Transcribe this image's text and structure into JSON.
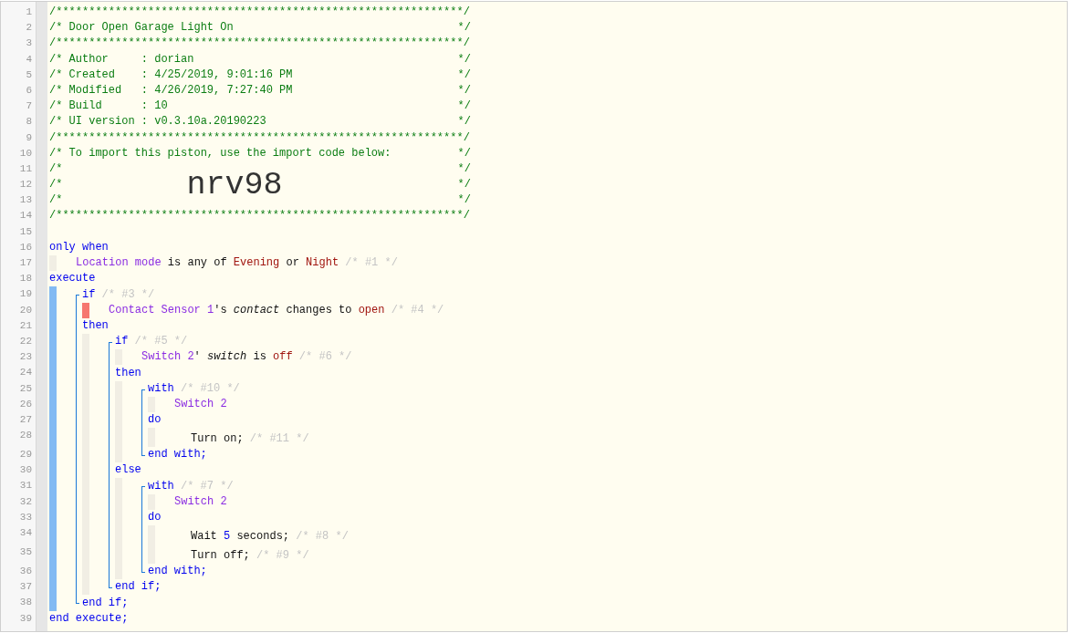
{
  "header": [
    {
      "number": "1",
      "text": "/**************************************************************/"
    },
    {
      "number": "2",
      "text": "/* Door Open Garage Light On",
      "end": "*/"
    },
    {
      "number": "3",
      "text": "/**************************************************************/"
    },
    {
      "number": "4",
      "text": "/* Author     : dorian",
      "end": "*/"
    },
    {
      "number": "5",
      "text": "/* Created    : 4/25/2019, 9:01:16 PM",
      "end": "*/"
    },
    {
      "number": "6",
      "text": "/* Modified   : 4/26/2019, 7:27:40 PM",
      "end": "*/"
    },
    {
      "number": "7",
      "text": "/* Build      : 10",
      "end": "*/"
    },
    {
      "number": "8",
      "text": "/* UI version : v0.3.10a.20190223",
      "end": "*/"
    },
    {
      "number": "9",
      "text": "/**************************************************************/"
    },
    {
      "number": "10",
      "text": "/* To import this piston, use the import code below:",
      "end": "*/"
    },
    {
      "number": "11",
      "text": "/*",
      "end": "*/"
    },
    {
      "number": "12",
      "text": "/*",
      "import_code": "nrv98",
      "end": "*/"
    },
    {
      "number": "13",
      "text": "/*",
      "end": "*/"
    },
    {
      "number": "14",
      "text": "/**************************************************************/"
    }
  ],
  "program": [
    {
      "kind": "line",
      "number": "15"
    },
    {
      "kind": "line",
      "number": "16",
      "tokens": [
        {
          "kind": "keyword",
          "text": "only when"
        }
      ]
    },
    {
      "kind": "body",
      "selected": false,
      "flagged": false,
      "children": [
        {
          "kind": "line",
          "number": "17",
          "tokens": [
            {
              "kind": "device",
              "text": "Location mode"
            },
            {
              "kind": "plain",
              "text": " is any of "
            },
            {
              "kind": "value",
              "text": "Evening"
            },
            {
              "kind": "plain",
              "text": " or "
            },
            {
              "kind": "value",
              "text": "Night"
            },
            {
              "kind": "hint",
              "text": " /* #1 */"
            }
          ]
        }
      ]
    },
    {
      "kind": "line",
      "number": "18",
      "tokens": [
        {
          "kind": "keyword",
          "text": "execute"
        }
      ]
    },
    {
      "kind": "body",
      "selected": true,
      "flagged": false,
      "children": [
        {
          "kind": "bracket",
          "children": [
            {
              "kind": "line",
              "number": "19",
              "tokens": [
                {
                  "kind": "keyword",
                  "text": "if"
                },
                {
                  "kind": "hint",
                  "text": " /* #3 */"
                }
              ]
            },
            {
              "kind": "body",
              "selected": false,
              "flagged": true,
              "children": [
                {
                  "kind": "line",
                  "number": "20",
                  "tokens": [
                    {
                      "kind": "device",
                      "text": "Contact Sensor 1"
                    },
                    {
                      "kind": "plain",
                      "text": "'s "
                    },
                    {
                      "kind": "attribute",
                      "text": "contact"
                    },
                    {
                      "kind": "plain",
                      "text": " changes to "
                    },
                    {
                      "kind": "value",
                      "text": "open"
                    },
                    {
                      "kind": "hint",
                      "text": " /* #4 */"
                    }
                  ]
                }
              ]
            },
            {
              "kind": "line",
              "number": "21",
              "tokens": [
                {
                  "kind": "keyword",
                  "text": "then"
                }
              ]
            },
            {
              "kind": "body",
              "selected": false,
              "flagged": false,
              "children": [
                {
                  "kind": "bracket",
                  "children": [
                    {
                      "kind": "line",
                      "number": "22",
                      "tokens": [
                        {
                          "kind": "keyword",
                          "text": "if"
                        },
                        {
                          "kind": "hint",
                          "text": " /* #5 */"
                        }
                      ]
                    },
                    {
                      "kind": "body",
                      "selected": false,
                      "flagged": false,
                      "children": [
                        {
                          "kind": "line",
                          "number": "23",
                          "tokens": [
                            {
                              "kind": "device",
                              "text": "Switch 2"
                            },
                            {
                              "kind": "plain",
                              "text": "' "
                            },
                            {
                              "kind": "attribute",
                              "text": "switch"
                            },
                            {
                              "kind": "plain",
                              "text": " is "
                            },
                            {
                              "kind": "value",
                              "text": "off"
                            },
                            {
                              "kind": "hint",
                              "text": " /* #6 */"
                            }
                          ]
                        }
                      ]
                    },
                    {
                      "kind": "line",
                      "number": "24",
                      "tokens": [
                        {
                          "kind": "keyword",
                          "text": "then"
                        }
                      ]
                    },
                    {
                      "kind": "body",
                      "selected": false,
                      "flagged": false,
                      "children": [
                        {
                          "kind": "bracket",
                          "children": [
                            {
                              "kind": "line",
                              "number": "25",
                              "tokens": [
                                {
                                  "kind": "keyword",
                                  "text": "with"
                                },
                                {
                                  "kind": "hint",
                                  "text": " /* #10 */"
                                }
                              ]
                            },
                            {
                              "kind": "body",
                              "selected": false,
                              "flagged": false,
                              "children": [
                                {
                                  "kind": "line",
                                  "number": "26",
                                  "tokens": [
                                    {
                                      "kind": "device",
                                      "text": "Switch 2"
                                    }
                                  ]
                                }
                              ]
                            },
                            {
                              "kind": "line",
                              "number": "27",
                              "tokens": [
                                {
                                  "kind": "keyword",
                                  "text": "do"
                                }
                              ]
                            },
                            {
                              "kind": "body",
                              "selected": false,
                              "flagged": false,
                              "children": [
                                {
                                  "kind": "action",
                                  "number": "28",
                                  "tokens": [
                                    {
                                      "kind": "plain",
                                      "text": "Turn on;"
                                    },
                                    {
                                      "kind": "hint",
                                      "text": " /* #11 */"
                                    }
                                  ]
                                }
                              ]
                            },
                            {
                              "kind": "line",
                              "number": "29",
                              "tokens": [
                                {
                                  "kind": "keyword",
                                  "text": "end with;"
                                }
                              ]
                            }
                          ]
                        }
                      ]
                    },
                    {
                      "kind": "line",
                      "number": "30",
                      "tokens": [
                        {
                          "kind": "keyword",
                          "text": "else"
                        }
                      ]
                    },
                    {
                      "kind": "body",
                      "selected": false,
                      "flagged": false,
                      "children": [
                        {
                          "kind": "bracket",
                          "children": [
                            {
                              "kind": "line",
                              "number": "31",
                              "tokens": [
                                {
                                  "kind": "keyword",
                                  "text": "with"
                                },
                                {
                                  "kind": "hint",
                                  "text": " /* #7 */"
                                }
                              ]
                            },
                            {
                              "kind": "body",
                              "selected": false,
                              "flagged": false,
                              "children": [
                                {
                                  "kind": "line",
                                  "number": "32",
                                  "tokens": [
                                    {
                                      "kind": "device",
                                      "text": "Switch 2"
                                    }
                                  ]
                                }
                              ]
                            },
                            {
                              "kind": "line",
                              "number": "33",
                              "tokens": [
                                {
                                  "kind": "keyword",
                                  "text": "do"
                                }
                              ]
                            },
                            {
                              "kind": "body",
                              "selected": false,
                              "flagged": false,
                              "children": [
                                {
                                  "kind": "action",
                                  "number": "34",
                                  "tokens": [
                                    {
                                      "kind": "plain",
                                      "text": "Wait "
                                    },
                                    {
                                      "kind": "number",
                                      "text": "5"
                                    },
                                    {
                                      "kind": "plain",
                                      "text": " seconds;"
                                    },
                                    {
                                      "kind": "hint",
                                      "text": " /* #8 */"
                                    }
                                  ]
                                },
                                {
                                  "kind": "action",
                                  "number": "35",
                                  "tokens": [
                                    {
                                      "kind": "plain",
                                      "text": "Turn off;"
                                    },
                                    {
                                      "kind": "hint",
                                      "text": " /* #9 */"
                                    }
                                  ]
                                }
                              ]
                            },
                            {
                              "kind": "line",
                              "number": "36",
                              "tokens": [
                                {
                                  "kind": "keyword",
                                  "text": "end with;"
                                }
                              ]
                            }
                          ]
                        }
                      ]
                    },
                    {
                      "kind": "line",
                      "number": "37",
                      "tokens": [
                        {
                          "kind": "keyword",
                          "text": "end if;"
                        }
                      ]
                    }
                  ]
                }
              ]
            },
            {
              "kind": "line",
              "number": "38",
              "tokens": [
                {
                  "kind": "keyword",
                  "text": "end if;"
                }
              ]
            }
          ]
        }
      ]
    },
    {
      "kind": "line",
      "number": "39",
      "tokens": [
        {
          "kind": "keyword",
          "text": "end execute;"
        }
      ]
    }
  ]
}
